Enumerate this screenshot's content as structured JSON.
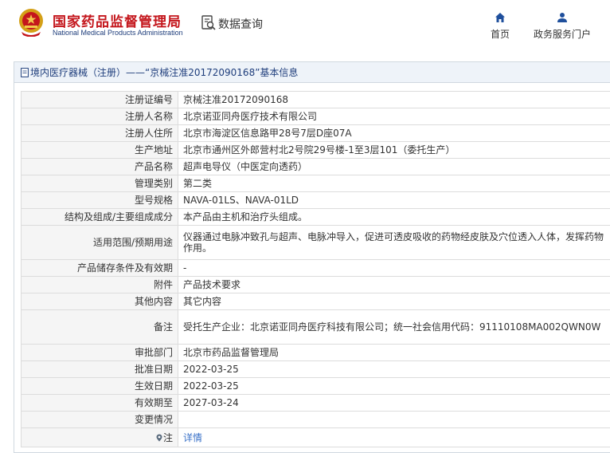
{
  "header": {
    "brand_cn": "国家药品监督管理局",
    "brand_en": "National Medical Products Administration",
    "query_label": "数据查询",
    "nav": [
      {
        "label": "首页",
        "icon": "home-icon"
      },
      {
        "label": "政务服务门户",
        "icon": "user-icon"
      }
    ]
  },
  "panel": {
    "title": "境内医疗器械（注册）——“京械注准20172090168”基本信息"
  },
  "rows": [
    {
      "label": "注册证编号",
      "value": "京械注准20172090168"
    },
    {
      "label": "注册人名称",
      "value": "北京诺亚同舟医疗技术有限公司"
    },
    {
      "label": "注册人住所",
      "value": "北京市海淀区信息路甲28号7层D座07A"
    },
    {
      "label": "生产地址",
      "value": "北京市通州区外郎营村北2号院29号楼-1至3层101（委托生产）"
    },
    {
      "label": "产品名称",
      "value": "超声电导仪（中医定向透药）"
    },
    {
      "label": "管理类别",
      "value": "第二类"
    },
    {
      "label": "型号规格",
      "value": "NAVA-01LS、NAVA-01LD"
    },
    {
      "label": "结构及组成/主要组成成分",
      "value": "本产品由主机和治疗头组成。"
    },
    {
      "label": "适用范围/预期用途",
      "value": "仪器通过电脉冲致孔与超声、电脉冲导入，促进可透皮吸收的药物经皮肤及穴位透入人体，发挥药物作用。"
    },
    {
      "label": "产品储存条件及有效期",
      "value": "-"
    },
    {
      "label": "附件",
      "value": "产品技术要求"
    },
    {
      "label": "其他内容",
      "value": "其它内容"
    },
    {
      "label": "备注",
      "value": "受托生产企业：北京诺亚同舟医疗科技有限公司；统一社会信用代码：91110108MA002QWN0W"
    },
    {
      "label": "审批部门",
      "value": "北京市药品监督管理局"
    },
    {
      "label": "批准日期",
      "value": "2022-03-25"
    },
    {
      "label": "生效日期",
      "value": "2022-03-25"
    },
    {
      "label": "有效期至",
      "value": "2027-03-24"
    },
    {
      "label": "变更情况",
      "value": ""
    },
    {
      "label": "注",
      "value": "详情",
      "icon": "pin-icon"
    }
  ],
  "colors": {
    "brand_red": "#c4161c",
    "navy": "#1f3e7c",
    "link": "#3a72c8",
    "label_bg": "#f5f5f5"
  }
}
